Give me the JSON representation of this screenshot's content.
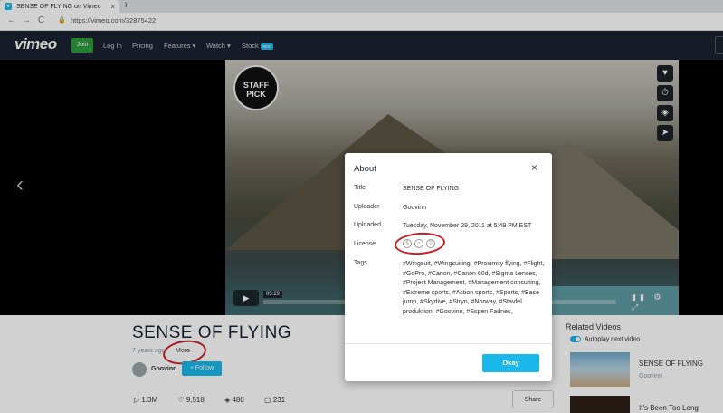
{
  "browser": {
    "tab_title": "SENSE OF FLYING on Vimeo",
    "tab_close": "×",
    "new_tab": "+",
    "url": "https://vimeo.com/32875422",
    "nav": {
      "back": "←",
      "forward": "→",
      "reload": "C",
      "lock": "🔒"
    }
  },
  "site_nav": {
    "logo": "vimeo",
    "join": "Join",
    "links": [
      "Log In",
      "Pricing",
      "Features ▾",
      "Watch ▾",
      "Stock"
    ],
    "stock_badge": "NEW"
  },
  "player": {
    "staff_pick": "STAFF PICK",
    "prev": "‹",
    "side_icons": {
      "like": "♥",
      "watch_later": "⏱",
      "collections": "◈",
      "share": "➤"
    },
    "play": "▶",
    "time": "05:29",
    "controls": "▮▮ ⚙ ⤢"
  },
  "video": {
    "title": "SENSE OF FLYING",
    "age": "7 years ago",
    "more": "More",
    "author": "Goovinn",
    "follow": "+ Follow",
    "stats": {
      "plays": "1.3M",
      "likes": "9,518",
      "collections": "480",
      "comments": "231"
    },
    "share": "Share"
  },
  "related": {
    "heading": "Related Videos",
    "autoplay": "Autoplay next video",
    "items": [
      {
        "title": "SENSE OF FLYING",
        "author": "Goovinn"
      },
      {
        "title": "It's Been Too Long",
        "author": ""
      }
    ]
  },
  "about_modal": {
    "title": "About",
    "close": "×",
    "rows": [
      {
        "label": "Title",
        "value": "SENSE OF FLYING"
      },
      {
        "label": "Uploader",
        "value": "Goovinn"
      },
      {
        "label": "Uploaded",
        "value": "Tuesday, November 29, 2011 at 5:49 PM EST"
      },
      {
        "label": "License",
        "value": ""
      },
      {
        "label": "Tags",
        "value": "#Wingsuit, #Wingsuiting, #Proximity flying, #Flight, #GoPro, #Canon, #Canon 60d, #Sigma Lenses, #Project Management, #Management consulting, #Extreme sports, #Action sports, #Sports, #Base jump, #Skydive, #Stryn, #Norway, #Stavfel produktion, #Goovinn, #Espen Fadnes,"
      }
    ],
    "license_icons": [
      "$",
      "=",
      "©"
    ],
    "okay": "Okay"
  }
}
